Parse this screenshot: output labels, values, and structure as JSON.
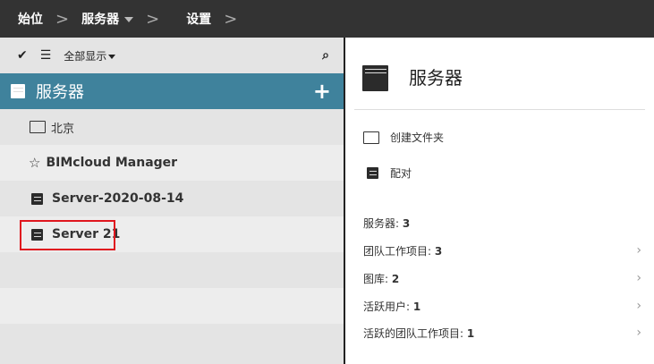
{
  "breadcrumb": {
    "home": "始位",
    "servers": "服务器",
    "settings": "设置"
  },
  "toolbar": {
    "filter": "全部显示"
  },
  "tree": {
    "header": "服务器",
    "items": [
      {
        "label": "北京",
        "icon": "folder-icon"
      },
      {
        "label": "BIMcloud Manager",
        "icon": "manager-icon"
      },
      {
        "label": "Server-2020-08-14",
        "icon": "server-icon"
      },
      {
        "label": "Server 21",
        "icon": "server-icon",
        "highlighted": true
      }
    ]
  },
  "panel": {
    "title": "服务器",
    "actions": [
      "创建文件夹",
      "配对"
    ],
    "stats": [
      {
        "label": "服务器: ",
        "value": "3",
        "chevron": false
      },
      {
        "label": "团队工作项目: ",
        "value": "3",
        "chevron": true
      },
      {
        "label": "图库: ",
        "value": "2",
        "chevron": true
      },
      {
        "label": "活跃用户: ",
        "value": "1",
        "chevron": true
      },
      {
        "label": "活跃的团队工作项目: ",
        "value": "1",
        "chevron": true
      }
    ]
  },
  "colors": {
    "header": "#3f829c",
    "highlight": "#e0161e",
    "topbar": "#333333"
  }
}
